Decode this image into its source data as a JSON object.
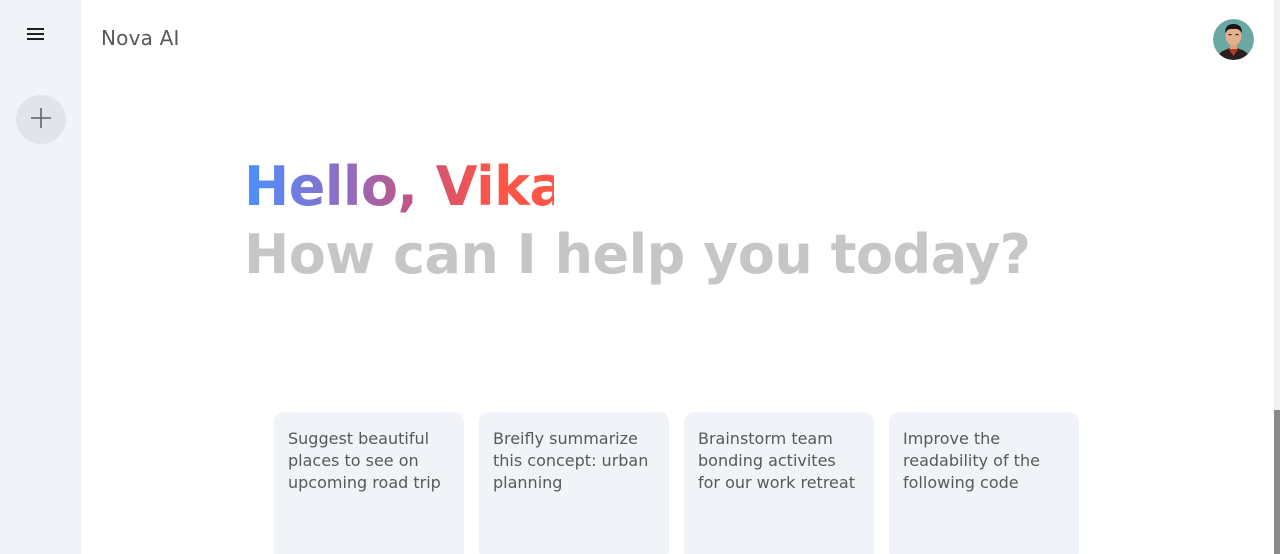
{
  "sidebar": {
    "menu_icon": "menu-icon",
    "new_chat_icon": "plus-icon"
  },
  "header": {
    "title": "Nova AI",
    "avatar": "user-avatar"
  },
  "greeting": {
    "hello": "Hello, Vikas.",
    "subtitle": "How can I help you today?"
  },
  "cards": [
    {
      "text": "Suggest beautiful places to see on upcoming road trip"
    },
    {
      "text": "Breifly summarize this concept: urban planning"
    },
    {
      "text": "Brainstorm team bonding activites for our work retreat"
    },
    {
      "text": "Improve the readability of the following code"
    }
  ],
  "colors": {
    "sidebar_bg": "#f0f4f9",
    "card_bg": "#f0f4f9",
    "gradient_start": "#4b90ff",
    "gradient_end": "#ff5546",
    "subtitle": "#c4c7c5"
  }
}
